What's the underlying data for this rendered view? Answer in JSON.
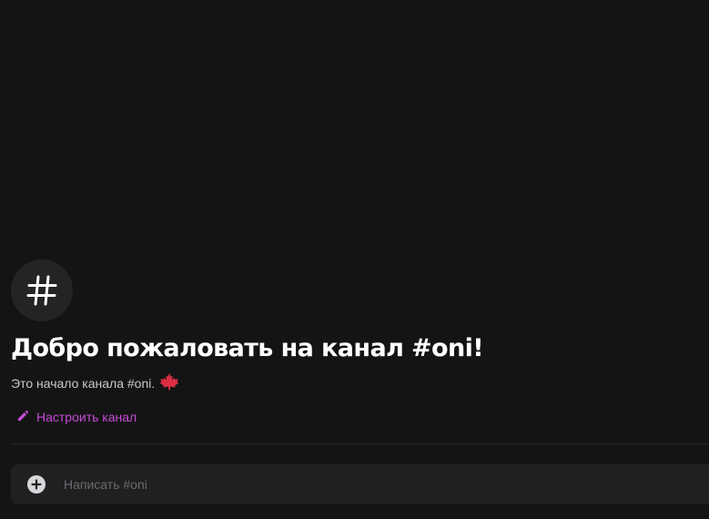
{
  "welcome": {
    "icon": "hash-icon",
    "title": "Добро пожаловать на канал #oni!",
    "description": "Это начало канала #oni.",
    "description_emoji": "maple-leaf-icon",
    "edit_icon": "pencil-icon",
    "edit_label": "Настроить канал"
  },
  "composer": {
    "attach_icon": "plus-circle-icon",
    "placeholder": "Написать #oni",
    "value": ""
  },
  "colors": {
    "background": "#141414",
    "composer_background": "#202020",
    "icon_circle": "#242424",
    "accent_link": "#c74bd9",
    "maple_leaf": "#dd2e44"
  }
}
